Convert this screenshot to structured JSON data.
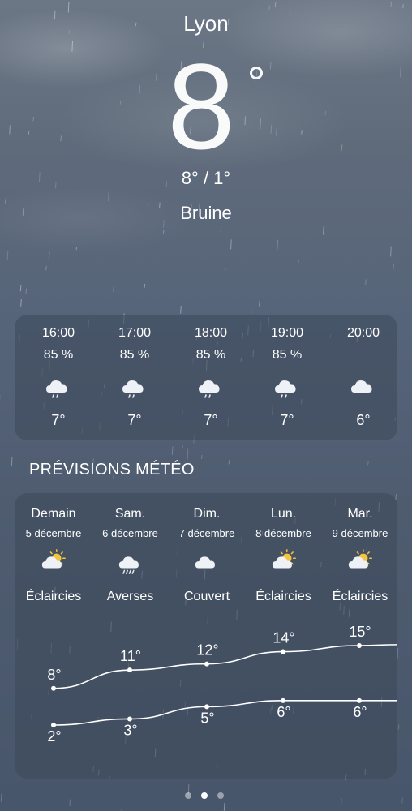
{
  "current": {
    "city": "Lyon",
    "temp": "8",
    "range": "8° / 1°",
    "condition": "Bruine"
  },
  "hourly": [
    {
      "time": "16:00",
      "humidity": "85 %",
      "icon": "cloud-drizzle-icon",
      "temp": "7°"
    },
    {
      "time": "17:00",
      "humidity": "85 %",
      "icon": "cloud-drizzle-icon",
      "temp": "7°"
    },
    {
      "time": "18:00",
      "humidity": "85 %",
      "icon": "cloud-drizzle-icon",
      "temp": "7°"
    },
    {
      "time": "19:00",
      "humidity": "85 %",
      "icon": "cloud-drizzle-icon",
      "temp": "7°"
    },
    {
      "time": "20:00",
      "humidity": "",
      "icon": "cloud-icon",
      "temp": "6°"
    }
  ],
  "forecast": {
    "title": "PRÉVISIONS MÉTÉO",
    "days": [
      {
        "day": "Demain",
        "date": "5 décembre",
        "icon": "sun-cloud-icon",
        "condition": "Éclaircies",
        "high": "8°",
        "low": "2°",
        "high_value": 8,
        "low_value": 2
      },
      {
        "day": "Sam.",
        "date": "6 décembre",
        "icon": "cloud-rain-icon",
        "condition": "Averses",
        "high": "11°",
        "low": "3°",
        "high_value": 11,
        "low_value": 3
      },
      {
        "day": "Dim.",
        "date": "7 décembre",
        "icon": "cloud-icon",
        "condition": "Couvert",
        "high": "12°",
        "low": "5°",
        "high_value": 12,
        "low_value": 5
      },
      {
        "day": "Lun.",
        "date": "8 décembre",
        "icon": "sun-cloud-icon",
        "condition": "Éclaircies",
        "high": "14°",
        "low": "6°",
        "high_value": 14,
        "low_value": 6
      },
      {
        "day": "Mar.",
        "date": "9 décembre",
        "icon": "sun-cloud-icon",
        "condition": "Éclaircies",
        "high": "15°",
        "low": "6°",
        "high_value": 15,
        "low_value": 6
      }
    ]
  },
  "pager": {
    "count": 3,
    "active": 1
  },
  "colors": {
    "cloud": "#eef1f5",
    "sun": "#f5c542",
    "rain": "#e6ebf2"
  }
}
